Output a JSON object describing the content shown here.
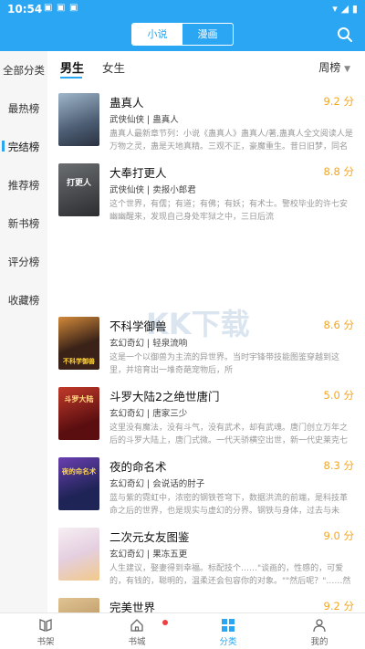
{
  "status": {
    "time": "10:54"
  },
  "header": {
    "tabs": [
      "小说",
      "漫画"
    ]
  },
  "sidebar": {
    "items": [
      "全部分类",
      "最热榜",
      "完结榜",
      "推荐榜",
      "新书榜",
      "评分榜",
      "收藏榜"
    ]
  },
  "filters": {
    "male": "男生",
    "female": "女生",
    "sort": "周榜"
  },
  "books": [
    {
      "title": "蛊真人",
      "score": "9.2 分",
      "tags": "武侠仙侠  |  蛊真人",
      "desc": "蛊真人最新章节列：小说《蛊真人》蛊真人/著,蛊真人全文阅读人是万物之灵，蛊是天地真精。三观不正，豪魔重生。昔日旧梦，同名新",
      "cover_text": "",
      "cover_bg": "#5a6f86"
    },
    {
      "title": "大奉打更人",
      "score": "8.8 分",
      "tags": "武侠仙侠  |  卖报小郎君",
      "desc": "这个世界，有儒；有道；有佛；有妖；有术士。警校毕业的许七安幽幽醒来，发现自己身处牢狱之中，三日后流",
      "cover_text": "打更人",
      "cover_bg": "#3d4247"
    },
    {
      "title": "不科学御兽",
      "score": "8.6 分",
      "tags": "玄幻奇幻  |  轻泉流响",
      "desc": "这是一个以御兽为主流的异世界。当时宇锋带技能图鉴穿越到这里，并培育出一堆奇葩宠物后，所",
      "cover_text": "不科学御兽",
      "cover_bg": "#3a2a22"
    },
    {
      "title": "斗罗大陆2之绝世唐门",
      "score": "5.0 分",
      "tags": "玄幻奇幻  |  唐家三少",
      "desc": "这里没有魔法，没有斗气，没有武术，却有武魂。唐门创立万年之后的斗罗大陆上，唐门式微。一代天骄横空出世，新一代史莱克七怪能",
      "cover_text": "斗罗大陆",
      "cover_bg": "#7a1a1a"
    },
    {
      "title": "夜的命名术",
      "score": "8.3 分",
      "tags": "玄幻奇幻  |  会说话的肘子",
      "desc": "蓝与紫的霓虹中，浓密的钢铁苍穹下，数据洪流的前端，是科技革命之后的世界，也是现实与虚幻的分界。钢铁与身体，过去与未来。这",
      "cover_text": "夜的命名术",
      "cover_bg": "#2c2f66"
    },
    {
      "title": "二次元女友图鉴",
      "score": "9.0 分",
      "tags": "玄幻奇幻  |  果冻五更",
      "desc": "人生建议，娶妻得到幸福。标配技个……\"谈画的，性感的，可爱的，有钱的，聪明的，温柔还会包容你的对象。\"\"然后呢？\"……然后别让",
      "cover_text": "",
      "cover_bg": "#e9dfe8"
    },
    {
      "title": "完美世界",
      "score": "9.2 分",
      "tags": "",
      "desc": "",
      "cover_text": "",
      "cover_bg": "#c8a372"
    }
  ],
  "watermark": "KK下载",
  "tabbar": [
    "书架",
    "书城",
    "分类",
    "我的"
  ],
  "colors": {
    "accent": "#2aa6f3",
    "score": "#f4a621",
    "badge": "#ef4040"
  }
}
